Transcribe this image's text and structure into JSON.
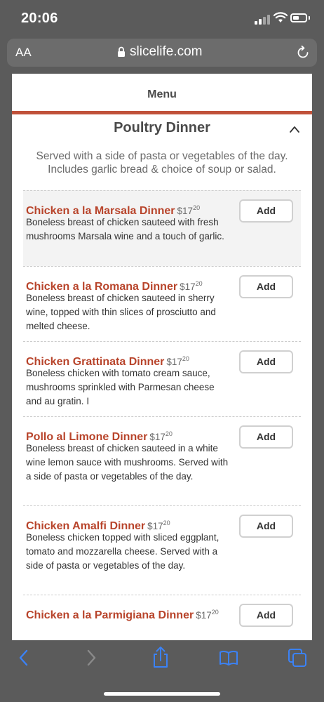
{
  "status_bar": {
    "time": "20:06"
  },
  "browser": {
    "aa_label": "AA",
    "url": "slicelife.com"
  },
  "menu": {
    "tab_label": "Menu",
    "section": {
      "title": "Poultry Dinner",
      "description": "Served with a side of pasta or vegetables of the day. Includes garlic bread & choice of soup or salad."
    },
    "add_label": "Add",
    "items": [
      {
        "name": "Chicken a la Marsala Dinner",
        "price_dollars": "$17",
        "price_cents": "20",
        "description": "Boneless breast of chicken sauteed with fresh mushrooms Marsala wine and a touch of garlic."
      },
      {
        "name": "Chicken a la Romana Dinner",
        "price_dollars": "$17",
        "price_cents": "20",
        "description": "Boneless breast of chicken sauteed in sherry wine, topped with thin slices of prosciutto and melted cheese."
      },
      {
        "name": "Chicken Grattinata Dinner",
        "price_dollars": "$17",
        "price_cents": "20",
        "description": "Boneless chicken with tomato cream sauce, mushrooms sprinkled with Parmesan cheese and au gratin. I"
      },
      {
        "name": "Pollo al Limone Dinner",
        "price_dollars": "$17",
        "price_cents": "20",
        "description": "Boneless breast of chicken sauteed in a white wine lemon sauce with mushrooms. Served with a side of pasta or vegetables of the day."
      },
      {
        "name": "Chicken Amalfi Dinner",
        "price_dollars": "$17",
        "price_cents": "20",
        "description": "Boneless chicken topped with sliced eggplant, tomato and mozzarella cheese. Served with a side of pasta or vegetables of the day."
      },
      {
        "name": "Chicken a la Parmigiana Dinner",
        "price_dollars": "$17",
        "price_cents": "20",
        "description": ""
      }
    ]
  },
  "colors": {
    "accent": "#c0513a",
    "item_name": "#b8442b",
    "toolbar_icon": "#3b82f6",
    "chrome": "#5b5b5b"
  },
  "toolbar": {
    "icons": [
      "back-icon",
      "forward-icon",
      "share-icon",
      "bookmarks-icon",
      "tabs-icon"
    ]
  }
}
